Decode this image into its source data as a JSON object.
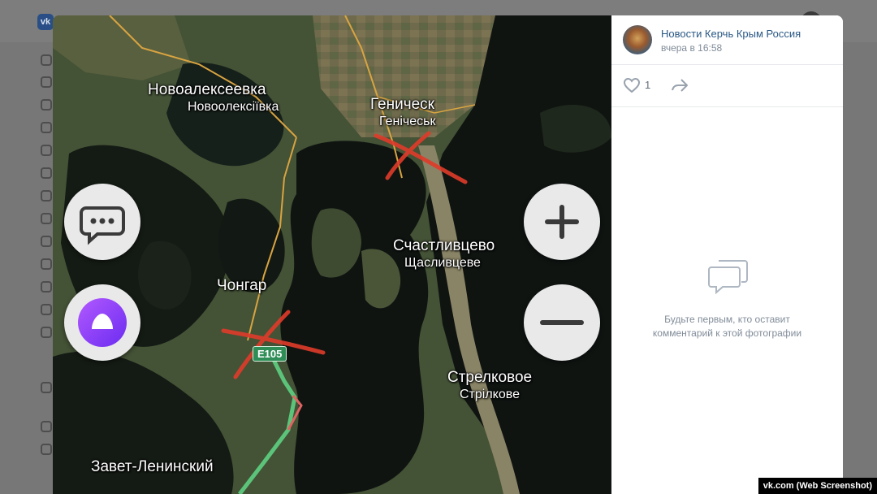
{
  "vk": {
    "logo": "vk"
  },
  "post": {
    "group_name": "Новости Керчь Крым Россия",
    "timestamp": "вчера в 16:58",
    "likes": "1",
    "like_icon": "heart-icon",
    "share_icon": "share-arrow-icon"
  },
  "comments": {
    "empty_icon": "comments-icon",
    "empty_line1": "Будьте первым, кто оставит",
    "empty_line2": "комментарий к этой фотографии"
  },
  "map": {
    "labels": {
      "novoalekseevka_ru": "Новоалексеевка",
      "novoalekseevka_ua": "Новоолексіївка",
      "genichesk_ru": "Геническ",
      "genichesk_ua": "Генічеськ",
      "schastlivtsevo_ru": "Счастливцево",
      "schastlivtsevo_ua": "Щасливцеве",
      "chongar": "Чонгар",
      "strelkovoe_ru": "Стрелковое",
      "strelkovoe_ua": "Стрілкове",
      "zavet_leninsky": "Завет-Ленинский"
    },
    "route_shield": "E105",
    "buttons": {
      "chat_icon": "chat-bubble-icon",
      "alice_icon": "alice-assistant-icon",
      "zoom_in_icon": "plus-icon",
      "zoom_out_icon": "minus-icon"
    },
    "colors": {
      "water": "#0f1411",
      "land": "#4d5a3a",
      "road": "#d9a441",
      "route": "#5bc47a",
      "cross": "#e03b2a"
    }
  },
  "watermark": "vk.com (Web Screenshot)"
}
